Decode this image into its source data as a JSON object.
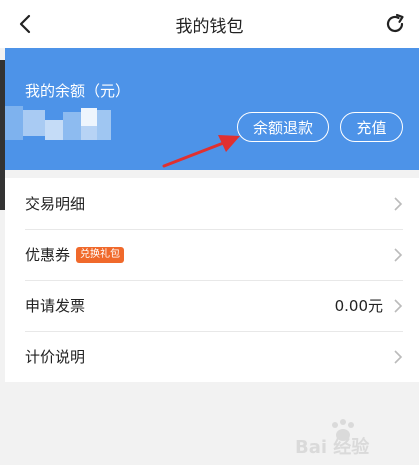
{
  "header": {
    "title": "我的钱包"
  },
  "banner": {
    "balance_label": "我的余额（元）",
    "refund_label": "余额退款",
    "recharge_label": "充值",
    "color": "#4d93e8"
  },
  "list": {
    "items": [
      {
        "label": "交易明细"
      },
      {
        "label": "优惠券",
        "badge": "兑换礼包"
      },
      {
        "label": "申请发票",
        "value": "0.00元"
      },
      {
        "label": "计价说明"
      }
    ]
  },
  "watermark": {
    "text": "Bai 经验"
  },
  "icons": {
    "back": "back-arrow-icon",
    "refresh": "refresh-icon",
    "chevron": "chevron-right-icon"
  }
}
